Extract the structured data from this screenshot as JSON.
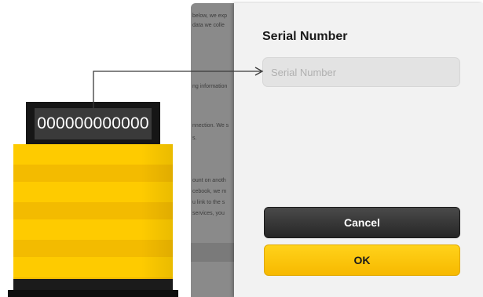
{
  "device": {
    "serial_display": "000000000000"
  },
  "background_app": {
    "lines": [
      "below, we exp",
      "data we colle",
      "ng information",
      "nnection. We s",
      "s.",
      "ount on anoth",
      "cebook, we m",
      "u link to the s",
      "services, you"
    ]
  },
  "dialog": {
    "title": "Serial Number",
    "serial_input": {
      "value": "",
      "placeholder": "Serial Number"
    },
    "cancel_label": "Cancel",
    "ok_label": "OK"
  },
  "colors": {
    "device_yellow": "#fecb00",
    "ok_button": "#fcc500",
    "cancel_button": "#2e2e2e"
  }
}
